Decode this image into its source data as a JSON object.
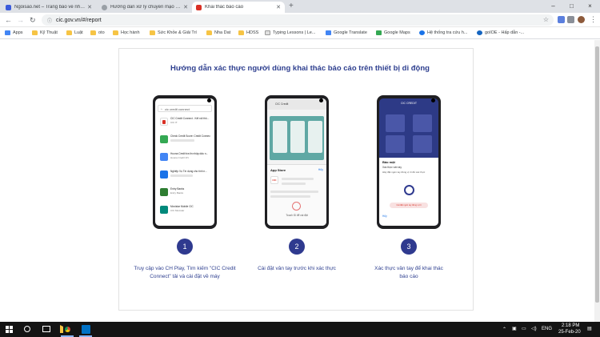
{
  "browser": {
    "tabs": [
      {
        "label": "Ngoisao.net – Trang báo về nhữn",
        "active": false,
        "favicon_color": "#3b5bdb"
      },
      {
        "label": "Hướng dẫn xử lý chuyến mạo dan",
        "active": false,
        "favicon_color": "#9aa0a6"
      },
      {
        "label": "Khai thác báo cáo",
        "active": true,
        "favicon_color": "#d93025"
      }
    ],
    "new_tab_label": "+",
    "window_controls": [
      "–",
      "□",
      "×"
    ],
    "url": "cic.gov.vn/#/report",
    "bookmarks": [
      {
        "label": "Apps",
        "icon": "apps-grid-icon"
      },
      {
        "label": "Kỹ Thuật",
        "icon": "folder-icon"
      },
      {
        "label": "Luật",
        "icon": "folder-icon"
      },
      {
        "label": "oto",
        "icon": "folder-icon"
      },
      {
        "label": "Học hành",
        "icon": "folder-icon"
      },
      {
        "label": "Sức Khỏe & Giải Trí",
        "icon": "folder-icon"
      },
      {
        "label": "Nha Dat",
        "icon": "folder-icon"
      },
      {
        "label": "HDSS",
        "icon": "folder-icon"
      },
      {
        "label": "Typing Lessons | Le...",
        "icon": "page-icon"
      },
      {
        "label": "Google Translate",
        "icon": "translate-icon"
      },
      {
        "label": "Google Maps",
        "icon": "maps-icon"
      },
      {
        "label": "Hệ thống tra cứu h...",
        "icon": "globe-icon"
      },
      {
        "label": "goIOE - Hấp dẫn -...",
        "icon": "ioe-icon"
      }
    ]
  },
  "page": {
    "title": "Hướng dẫn xác thực người dùng khai thác báo cáo trên thiết bị di động",
    "steps": [
      {
        "number": "1",
        "caption": "Truy cập vào CH Play, Tìm kiếm \"CIC Credit Connect\" tải và cài đặt về máy"
      },
      {
        "number": "2",
        "caption": "Cài đặt vân tay trước khi xác thực"
      },
      {
        "number": "3",
        "caption": "Xác thực vân tay để khai thác báo cáo"
      }
    ],
    "phone1": {
      "search_text": "cic credit connect",
      "apps": [
        {
          "name": "CIC Credit Connect - Kết nối thô...",
          "sub": "CIC IT",
          "color": "#d93025"
        },
        {
          "name": "Check Credit Score: Credit Connec...",
          "sub": "",
          "color": "#34a853"
        },
        {
          "name": "Huona Credit tra tin nhập dấu n...",
          "sub": "Huona Credit VN",
          "color": "#4285f4"
        },
        {
          "name": "Nghiệp Vụ Tín dụng cho tính n...",
          "sub": "",
          "color": "#1a73e8"
        },
        {
          "name": "Entry Banks",
          "sub": "Entry Banks",
          "color": "#2e7d32"
        },
        {
          "name": "Movistar Mobile CIC",
          "sub": "CIC Movistar",
          "color": "#00897b"
        }
      ]
    },
    "phone2": {
      "header": "CIC Credit",
      "sheet_title": "App Store",
      "sheet_action": "Hủy",
      "app_name": "CIC",
      "touch_text": "Touch ID để cài đặt"
    },
    "phone3": {
      "header": "CIC CREDIT",
      "dialog_title": "Bảo mật",
      "dialog_sub": "Xác thực vân tay",
      "dialog_text": "Hãy đặt ngón tay đúng vị trí để xác thực",
      "button_text": "Cài đặt ngón tay đúng vị trí",
      "cancel_text": "Hủy"
    }
  },
  "taskbar": {
    "language": "ENG",
    "time": "2:18 PM",
    "date": "25-Feb-20"
  }
}
